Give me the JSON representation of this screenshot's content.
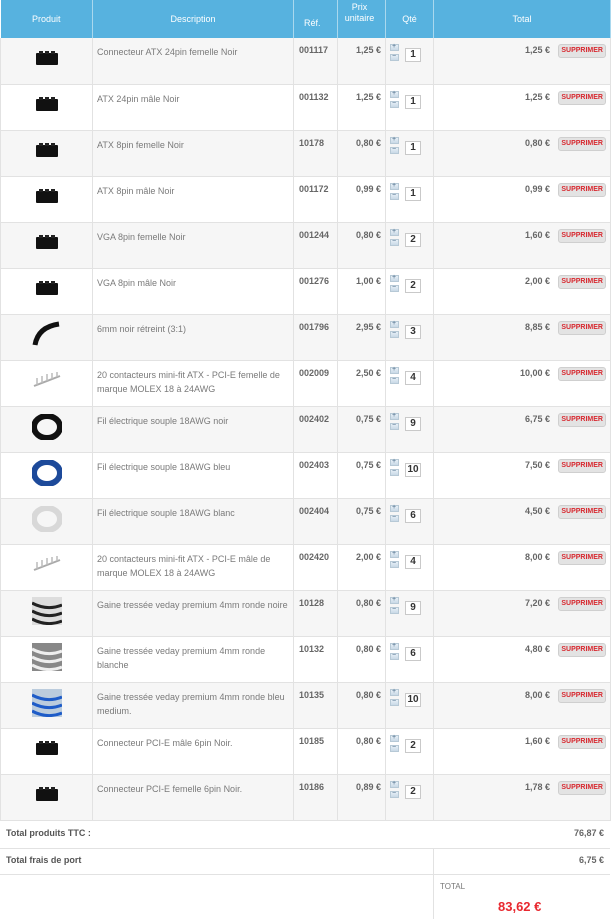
{
  "headers": {
    "produit": "Produit",
    "description": "Description",
    "ref": "Réf.",
    "unit_line1": "Prix",
    "unit_line2": "unitaire",
    "qty": "Qté",
    "total": "Total"
  },
  "delete_label": "SUPPRIMER",
  "items": [
    {
      "desc": "Connecteur ATX 24pin femelle Noir",
      "ref": "001117",
      "unit": "1,25 €",
      "qty": "1",
      "total": "1,25 €",
      "img": "connector-black"
    },
    {
      "desc": "ATX 24pin mâle Noir",
      "ref": "001132",
      "unit": "1,25 €",
      "qty": "1",
      "total": "1,25 €",
      "img": "connector-black"
    },
    {
      "desc": "ATX 8pin femelle Noir",
      "ref": "10178",
      "unit": "0,80 €",
      "qty": "1",
      "total": "0,80 €",
      "img": "connector-black"
    },
    {
      "desc": "ATX 8pin mâle Noir",
      "ref": "001172",
      "unit": "0,99 €",
      "qty": "1",
      "total": "0,99 €",
      "img": "connector-black"
    },
    {
      "desc": "VGA 8pin femelle Noir",
      "ref": "001244",
      "unit": "0,80 €",
      "qty": "2",
      "total": "1,60 €",
      "img": "connector-black"
    },
    {
      "desc": "VGA 8pin mâle Noir",
      "ref": "001276",
      "unit": "1,00 €",
      "qty": "2",
      "total": "2,00 €",
      "img": "connector-black"
    },
    {
      "desc": "6mm noir rétreint (3:1)",
      "ref": "001796",
      "unit": "2,95 €",
      "qty": "3",
      "total": "8,85 €",
      "img": "tube-black"
    },
    {
      "desc": "20 contacteurs mini-fit ATX - PCI-E femelle de marque MOLEX 18 à 24AWG",
      "ref": "002009",
      "unit": "2,50 €",
      "qty": "4",
      "total": "10,00 €",
      "img": "pins"
    },
    {
      "desc": "Fil électrique souple 18AWG noir",
      "ref": "002402",
      "unit": "0,75 €",
      "qty": "9",
      "total": "6,75 €",
      "img": "coil-black"
    },
    {
      "desc": "Fil électrique souple 18AWG bleu",
      "ref": "002403",
      "unit": "0,75 €",
      "qty": "10",
      "total": "7,50 €",
      "img": "coil-blue"
    },
    {
      "desc": "Fil électrique souple 18AWG blanc",
      "ref": "002404",
      "unit": "0,75 €",
      "qty": "6",
      "total": "4,50 €",
      "img": "coil-white"
    },
    {
      "desc": "20 contacteurs mini-fit ATX - PCI-E mâle de marque MOLEX 18 à 24AWG",
      "ref": "002420",
      "unit": "2,00 €",
      "qty": "4",
      "total": "8,00 €",
      "img": "pins"
    },
    {
      "desc": "Gaine tressée veday premium 4mm ronde noire",
      "ref": "10128",
      "unit": "0,80 €",
      "qty": "9",
      "total": "7,20 €",
      "img": "sleeve-black"
    },
    {
      "desc": "Gaine tressée veday premium 4mm ronde blanche",
      "ref": "10132",
      "unit": "0,80 €",
      "qty": "6",
      "total": "4,80 €",
      "img": "sleeve-white"
    },
    {
      "desc": "Gaine tressée veday premium 4mm ronde bleu medium.",
      "ref": "10135",
      "unit": "0,80 €",
      "qty": "10",
      "total": "8,00 €",
      "img": "sleeve-blue"
    },
    {
      "desc": "Connecteur PCI-E mâle 6pin Noir.",
      "ref": "10185",
      "unit": "0,80 €",
      "qty": "2",
      "total": "1,60 €",
      "img": "connector-black"
    },
    {
      "desc": "Connecteur PCI-E femelle 6pin Noir.",
      "ref": "10186",
      "unit": "0,89 €",
      "qty": "2",
      "total": "1,78 €",
      "img": "connector-black"
    }
  ],
  "summary": {
    "products_label": "Total produits TTC :",
    "products_value": "76,87 €",
    "shipping_label": "Total frais de port",
    "shipping_value": "6,75 €",
    "grand_label": "TOTAL",
    "grand_value": "83,62 €"
  },
  "colors": {
    "header_bg": "#57b2df",
    "accent_red": "#e8282f"
  }
}
